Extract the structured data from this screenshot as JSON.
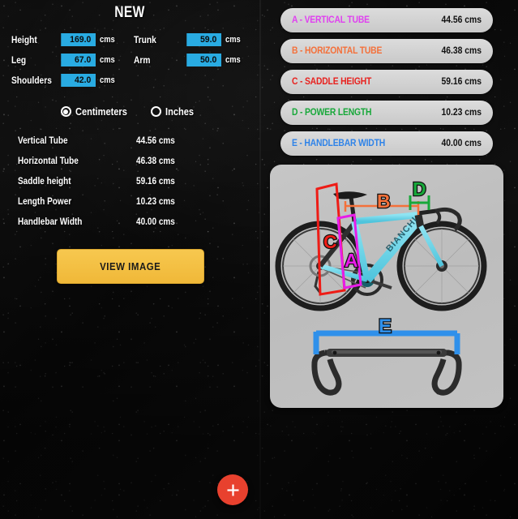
{
  "title": "NEW",
  "form": {
    "fields": [
      {
        "label": "Height",
        "value": "169.0",
        "unit": "cms"
      },
      {
        "label": "Trunk",
        "value": "59.0",
        "unit": "cms"
      },
      {
        "label": "Leg",
        "value": "67.0",
        "unit": "cms"
      },
      {
        "label": "Arm",
        "value": "50.0",
        "unit": "cms"
      },
      {
        "label": "Shoulders",
        "value": "42.0",
        "unit": "cms"
      }
    ],
    "input_color": "#29abe2"
  },
  "units": {
    "options": [
      {
        "label": "Centimeters",
        "selected": true
      },
      {
        "label": "Inches",
        "selected": false
      }
    ]
  },
  "results": {
    "rows": [
      {
        "name": "Vertical Tube",
        "value": "44.56 cms"
      },
      {
        "name": "Horizontal Tube",
        "value": "46.38 cms"
      },
      {
        "name": "Saddle height",
        "value": "59.16 cms"
      },
      {
        "name": "Length Power",
        "value": "10.23 cms"
      },
      {
        "name": "Handlebar Width",
        "value": "40.00 cms"
      }
    ]
  },
  "view_button": {
    "label": "VIEW IMAGE",
    "color": "#f2bb3c"
  },
  "measurements": {
    "pills": [
      {
        "label": "A - VERTICAL TUBE",
        "value": "44.56 cms",
        "color": "#e040f0",
        "letter": "A"
      },
      {
        "label": "B - HORIZONTAL TUBE",
        "value": "46.38 cms",
        "color": "#f4703a",
        "letter": "B"
      },
      {
        "label": "C - SADDLE HEIGHT",
        "value": "59.16 cms",
        "color": "#e8221f",
        "letter": "C"
      },
      {
        "label": "D - POWER LENGTH",
        "value": "10.23 cms",
        "color": "#18a83a",
        "letter": "D"
      },
      {
        "label": "E - HANDLEBAR WIDTH",
        "value": "40.00 cms",
        "color": "#2f83e8",
        "letter": "E"
      }
    ]
  },
  "diagram": {
    "bike_frame_color": "#6fd8ea",
    "brand_text": "BIANCHI",
    "labels": {
      "a": "A",
      "b": "B",
      "c": "C",
      "d": "D",
      "e": "E"
    }
  },
  "fab": {
    "icon": "plus-icon",
    "color": "#e8412e"
  }
}
